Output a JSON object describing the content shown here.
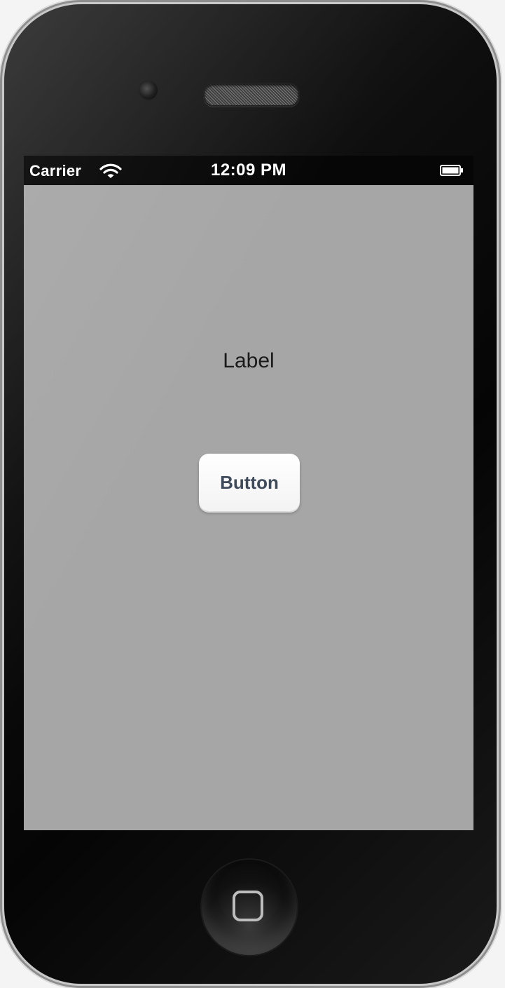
{
  "status_bar": {
    "carrier": "Carrier",
    "time": "12:09 PM",
    "wifi_icon": "wifi-icon",
    "battery_icon": "battery-icon"
  },
  "content": {
    "label_text": "Label",
    "button_label": "Button"
  },
  "device": {
    "home_icon": "home-button-icon",
    "screen_background": "#a6a6a6",
    "status_bar_background": "#060606"
  }
}
